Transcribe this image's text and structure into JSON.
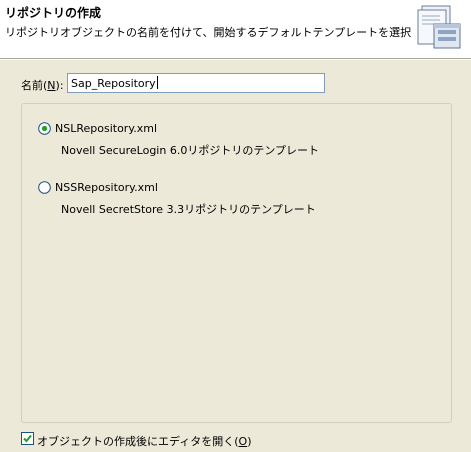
{
  "header": {
    "title": "リポジトリの作成",
    "description": "リポジトリオブジェクトの名前を付けて、開始するデフォルトテンプレートを選択します"
  },
  "name_field": {
    "label_prefix": "名前(",
    "label_mnemonic": "N",
    "label_suffix": "):",
    "value": "Sap_Repository"
  },
  "templates": [
    {
      "name": "NSLRepository.xml",
      "description": "Novell SecureLogin 6.0リポジトリのテンプレート",
      "selected": true
    },
    {
      "name": "NSSRepository.xml",
      "description": "Novell SecretStore 3.3リポジトリのテンプレート",
      "selected": false
    }
  ],
  "open_editor": {
    "label": "オブジェクトの作成後にエディタを開く(",
    "mnemonic": "O",
    "suffix": ")",
    "checked": true
  }
}
